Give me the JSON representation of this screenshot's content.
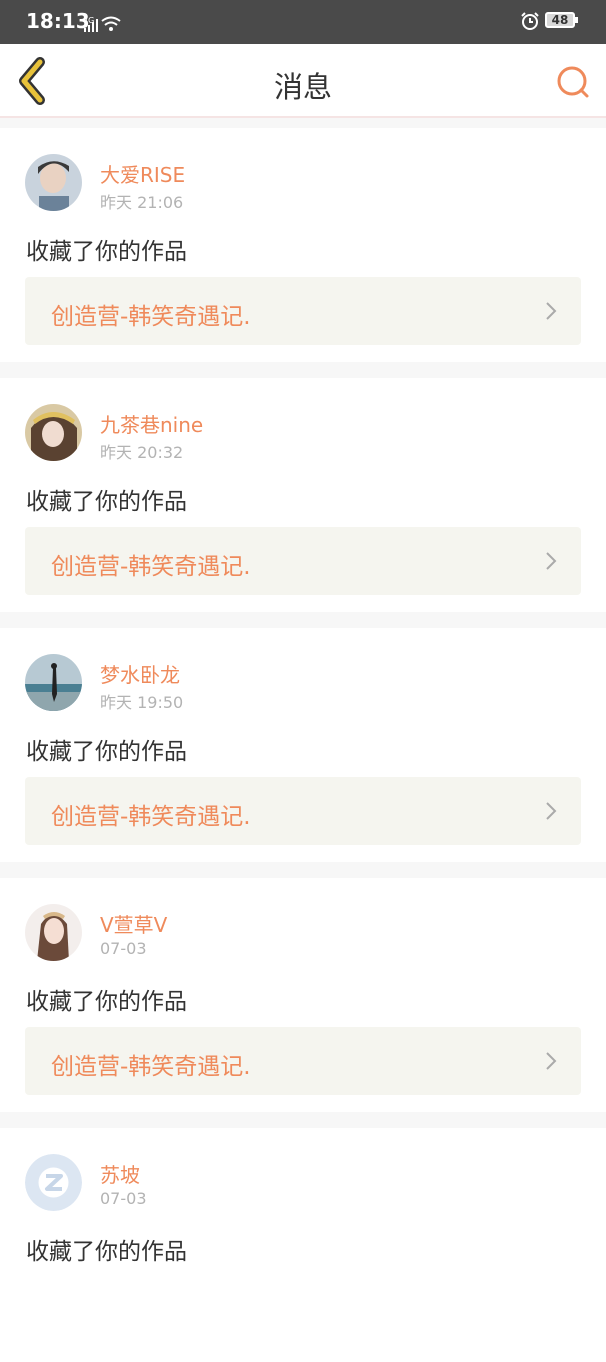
{
  "status_bar": {
    "time": "18:13",
    "network": "4G",
    "battery": "48"
  },
  "nav": {
    "title": "消息"
  },
  "messages": [
    {
      "username": "大爱RISE",
      "time": "昨天 21:06",
      "action": "收藏了你的作品",
      "work_title": "创造营-韩笑奇遇记."
    },
    {
      "username": "九茶巷nine",
      "time": "昨天 20:32",
      "action": "收藏了你的作品",
      "work_title": "创造营-韩笑奇遇记."
    },
    {
      "username": "梦水卧龙",
      "time": "昨天 19:50",
      "action": "收藏了你的作品",
      "work_title": "创造营-韩笑奇遇记."
    },
    {
      "username": "V萱草V",
      "time": "07-03",
      "action": "收藏了你的作品",
      "work_title": "创造营-韩笑奇遇记."
    },
    {
      "username": "苏坡",
      "time": "07-03",
      "action": "收藏了你的作品",
      "work_title": ""
    }
  ],
  "colors": {
    "accent": "#ef8a5b",
    "back_icon": "#e8c23a",
    "text": "#333333",
    "muted": "#b3b3b3"
  }
}
